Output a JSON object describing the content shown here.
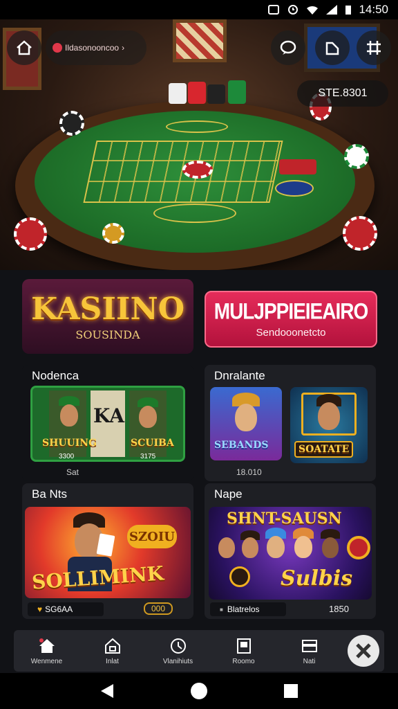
{
  "status_bar": {
    "time": "14:50"
  },
  "hero": {
    "search_text": "Ildasonooncoo",
    "balance": "STE.8301"
  },
  "banners": {
    "left": {
      "title": "KASIINO",
      "subtitle": "SOUSINDA"
    },
    "right": {
      "title": "MULJPPIEIEAIRO",
      "subtitle": "Sendooonetcto"
    }
  },
  "sections": [
    {
      "title": "Nodenca",
      "tiles": [
        {
          "label": "SHUUING",
          "value": "3300"
        },
        {
          "label": "SCUIBA",
          "value": "3175"
        }
      ],
      "caption": "Sat"
    },
    {
      "title": "Dnralante",
      "tiles": [
        {
          "label": "SEBANDS"
        },
        {
          "label": "SOATATE"
        }
      ],
      "caption": "18.010"
    },
    {
      "title": "Ba Nts",
      "badge": "SZOIU",
      "game_title": "SOLLIMINK",
      "footer_left": "SG6AA",
      "footer_right": "000"
    },
    {
      "title": "Nape",
      "game_title_top": "SHNT-SAUSN",
      "game_title_bottom": "Sulbis",
      "footer_left": "Blatrelos",
      "footer_right": "1850"
    }
  ],
  "nav": [
    {
      "label": "Wenmene",
      "icon": "home-icon"
    },
    {
      "label": "Inlat",
      "icon": "house-icon"
    },
    {
      "label": "Vlanihiuts",
      "icon": "history-icon"
    },
    {
      "label": "Roomo",
      "icon": "room-icon"
    },
    {
      "label": "Nati",
      "icon": "cards-icon"
    }
  ],
  "colors": {
    "accent": "#e52c5a",
    "gold": "#f7c53a",
    "felt": "#1c6b27"
  }
}
